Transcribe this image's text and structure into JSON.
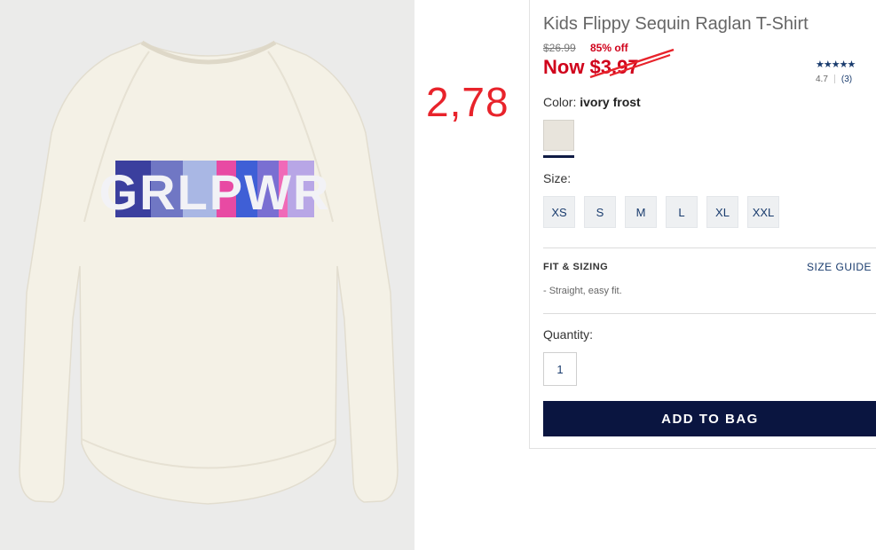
{
  "product": {
    "title": "Kids Flippy Sequin Raglan T-Shirt",
    "original_price": "$26.99",
    "discount": "85% off",
    "now_price": "Now $3.97",
    "graphic_text": "GRLPWR"
  },
  "annotation": {
    "text": "2,78"
  },
  "rating": {
    "stars": "★★★★★",
    "score": "4.7",
    "count": "(3)"
  },
  "color": {
    "label": "Color:",
    "value": "ivory frost",
    "swatch_hex": "#e8e4dc"
  },
  "size": {
    "label": "Size:",
    "options": [
      "XS",
      "S",
      "M",
      "L",
      "XL",
      "XXL"
    ]
  },
  "fit": {
    "title": "FIT & SIZING",
    "size_guide_label": "SIZE GUIDE",
    "description": "- Straight, easy fit."
  },
  "quantity": {
    "label": "Quantity:",
    "value": "1"
  },
  "actions": {
    "add_to_bag": "ADD TO BAG"
  },
  "colors": {
    "brand_navy": "#0a1540",
    "sale_red": "#d0021b",
    "annotation_red": "#e8232b"
  }
}
